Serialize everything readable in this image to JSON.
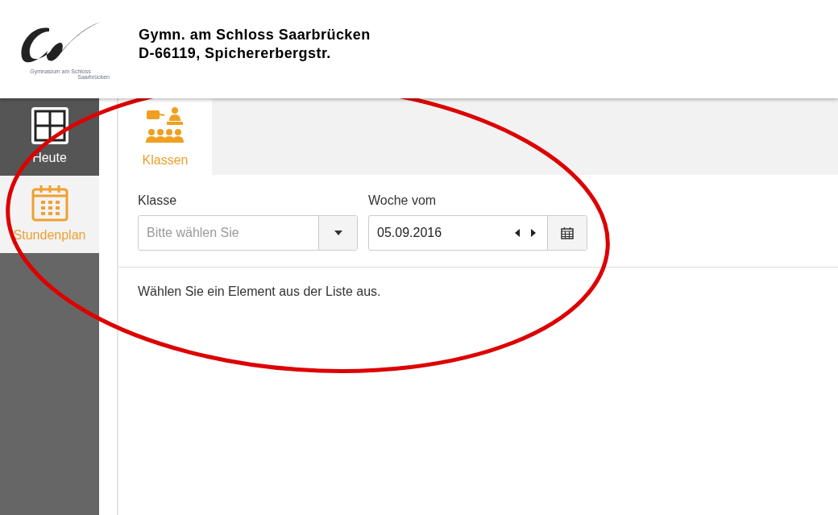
{
  "header": {
    "logo_text": [
      "Gymnasium am Schloss",
      "Saarbrücken"
    ],
    "school_name": "Gymn. am Schloss Saarbrücken",
    "address": "D-66119, Spichererbergstr."
  },
  "sidebar": {
    "items": [
      {
        "kind": "grid",
        "label": "Heute",
        "selected": false
      },
      {
        "kind": "calendar",
        "label": "Stundenplan",
        "selected": true
      }
    ]
  },
  "tabs": [
    {
      "label": "Klassen",
      "selected": true
    }
  ],
  "form": {
    "class_label": "Klasse",
    "class_placeholder": "Bitte wählen Sie",
    "week_label": "Woche vom",
    "week_value": "05.09.2016"
  },
  "message": "Wählen Sie ein Element aus der Liste aus."
}
